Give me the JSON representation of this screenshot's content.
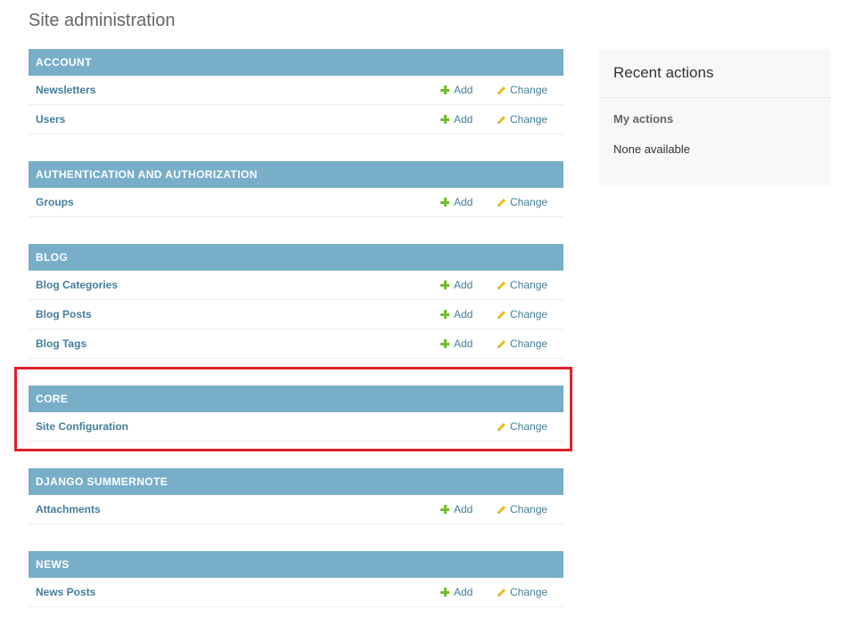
{
  "page_title": "Site administration",
  "colors": {
    "module_header_bg": "#79aec8",
    "link": "#447e9b",
    "add_icon": "#70bf2b",
    "change_icon": "#efb80b",
    "highlight": "#e0202a"
  },
  "actions": {
    "add_label": "Add",
    "change_label": "Change",
    "add_icon": "plus-icon",
    "change_icon": "pencil-icon"
  },
  "modules": [
    {
      "caption": "ACCOUNT",
      "models": [
        {
          "name": "Newsletters",
          "has_add": true,
          "has_change": true
        },
        {
          "name": "Users",
          "has_add": true,
          "has_change": true
        }
      ]
    },
    {
      "caption": "AUTHENTICATION AND AUTHORIZATION",
      "models": [
        {
          "name": "Groups",
          "has_add": true,
          "has_change": true
        }
      ]
    },
    {
      "caption": "BLOG",
      "models": [
        {
          "name": "Blog Categories",
          "has_add": true,
          "has_change": true
        },
        {
          "name": "Blog Posts",
          "has_add": true,
          "has_change": true
        },
        {
          "name": "Blog Tags",
          "has_add": true,
          "has_change": true
        }
      ]
    },
    {
      "caption": "CORE",
      "highlighted": true,
      "models": [
        {
          "name": "Site Configuration",
          "has_add": false,
          "has_change": true
        }
      ]
    },
    {
      "caption": "DJANGO SUMMERNOTE",
      "models": [
        {
          "name": "Attachments",
          "has_add": true,
          "has_change": true
        }
      ]
    },
    {
      "caption": "NEWS",
      "models": [
        {
          "name": "News Posts",
          "has_add": true,
          "has_change": true
        }
      ]
    }
  ],
  "sidebar": {
    "title": "Recent actions",
    "subtitle": "My actions",
    "empty_text": "None available"
  }
}
